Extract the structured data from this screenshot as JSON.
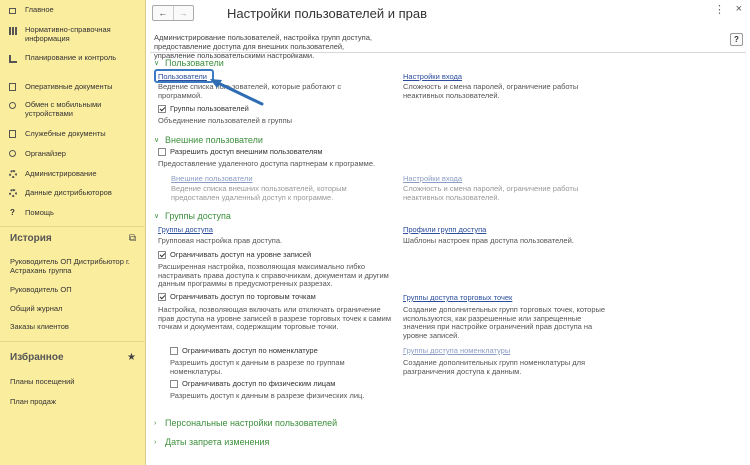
{
  "sidebar": {
    "nav": [
      {
        "label": "Главное",
        "icon": "home-icon"
      },
      {
        "label": "Нормативно-справочная информация",
        "icon": "reference-icon"
      },
      {
        "label": "Планирование и контроль",
        "icon": "chart-icon"
      },
      {
        "label": "Оперативные документы",
        "icon": "document-icon"
      },
      {
        "label": "Обмен с мобильными устройствами",
        "icon": "exchange-icon"
      },
      {
        "label": "Служебные документы",
        "icon": "service-doc-icon"
      },
      {
        "label": "Органайзер",
        "icon": "organizer-icon"
      },
      {
        "label": "Администрирование",
        "icon": "gear-icon"
      },
      {
        "label": "Данные дистрибьюторов",
        "icon": "distributor-icon"
      },
      {
        "label": "Помощь",
        "icon": "help-icon"
      }
    ],
    "history": {
      "title": "История",
      "items": [
        "Руководитель ОП Дистрибьютор г. Астрахань группа",
        "Руководитель ОП",
        "Общий журнал",
        "Заказы клиентов"
      ]
    },
    "favorites": {
      "title": "Избранное",
      "items": [
        "Планы посещений",
        "План продаж"
      ]
    }
  },
  "window": {
    "title": "Настройки пользователей и прав",
    "back": "←",
    "forward": "→",
    "menu": "⋮",
    "close": "×",
    "help": "?",
    "description": "Администрирование пользователей, настройка групп доступа, предоставление доступа для внешних пользователей, управление пользовательскими настройками."
  },
  "groups": {
    "users": {
      "title": "Пользователи",
      "users_link": "Пользователи",
      "users_desc": "Ведение списка пользователей, которые работают с программой.",
      "login_link": "Настройки входа",
      "login_desc": "Сложность и смена паролей, ограничение работы неактивных пользователей.",
      "groups_check": "Группы пользователей",
      "groups_desc": "Объединение пользователей в группы"
    },
    "external": {
      "title": "Внешние пользователи",
      "allow_check": "Разрешить доступ внешним пользователям",
      "allow_desc": "Предоставление удаленного доступа партнерам к программе.",
      "ext_link": "Внешние пользователи",
      "ext_desc": "Ведение списка внешних пользователей, которым предоставлен удаленный доступ к программе.",
      "login_link": "Настройки входа",
      "login_desc": "Сложность и смена паролей, ограничение работы неактивных пользователей."
    },
    "access": {
      "title": "Группы доступа",
      "groups_link": "Группы доступа",
      "groups_desc": "Групповая настройка прав доступа.",
      "profiles_link": "Профили групп доступа",
      "profiles_desc": "Шаблоны настроек прав доступа пользователей.",
      "rls_check": "Ограничивать доступ на уровне записей",
      "rls_desc": "Расширенная настройка, позволяющая максимально гибко настраивать права доступа к справочникам, документам и другим данным программы в предусмотренных разрезах.",
      "points_check": "Ограничивать доступ по торговым точкам",
      "points_desc": "Настройка, позволяющая включать или отключать ограничение прав доступа на уровне записей в разрезе торговых точек к самим точкам и документам, содержащим торговые точки.",
      "points_link": "Группы доступа торговых точек",
      "points_link_desc": "Создание дополнительных групп торговых точек, которые используются, как разрешенные или запрещенные значения при настройке ограничений прав доступа на уровне записей.",
      "nomen_check": "Ограничивать доступ по номенклатуре",
      "nomen_desc": "Разрешить доступ к данным в разрезе по группам номенклатуры.",
      "nomen_link": "Группы доступа номенклатуры",
      "nomen_link_desc": "Создание дополнительных групп номенклатуры для разграничения доступа к данным.",
      "phys_check": "Ограничивать доступ по физическим лицам",
      "phys_desc": "Разрешить доступ к данным в разрезе физических лиц."
    },
    "personal": {
      "title": "Персональные настройки пользователей"
    },
    "dates": {
      "title": "Даты запрета изменения"
    }
  },
  "colors": {
    "sidebar_bg": "#fbed9e",
    "group_title": "#3c8f3c",
    "link": "#2a4d9c",
    "highlight": "#3a7bc4"
  }
}
